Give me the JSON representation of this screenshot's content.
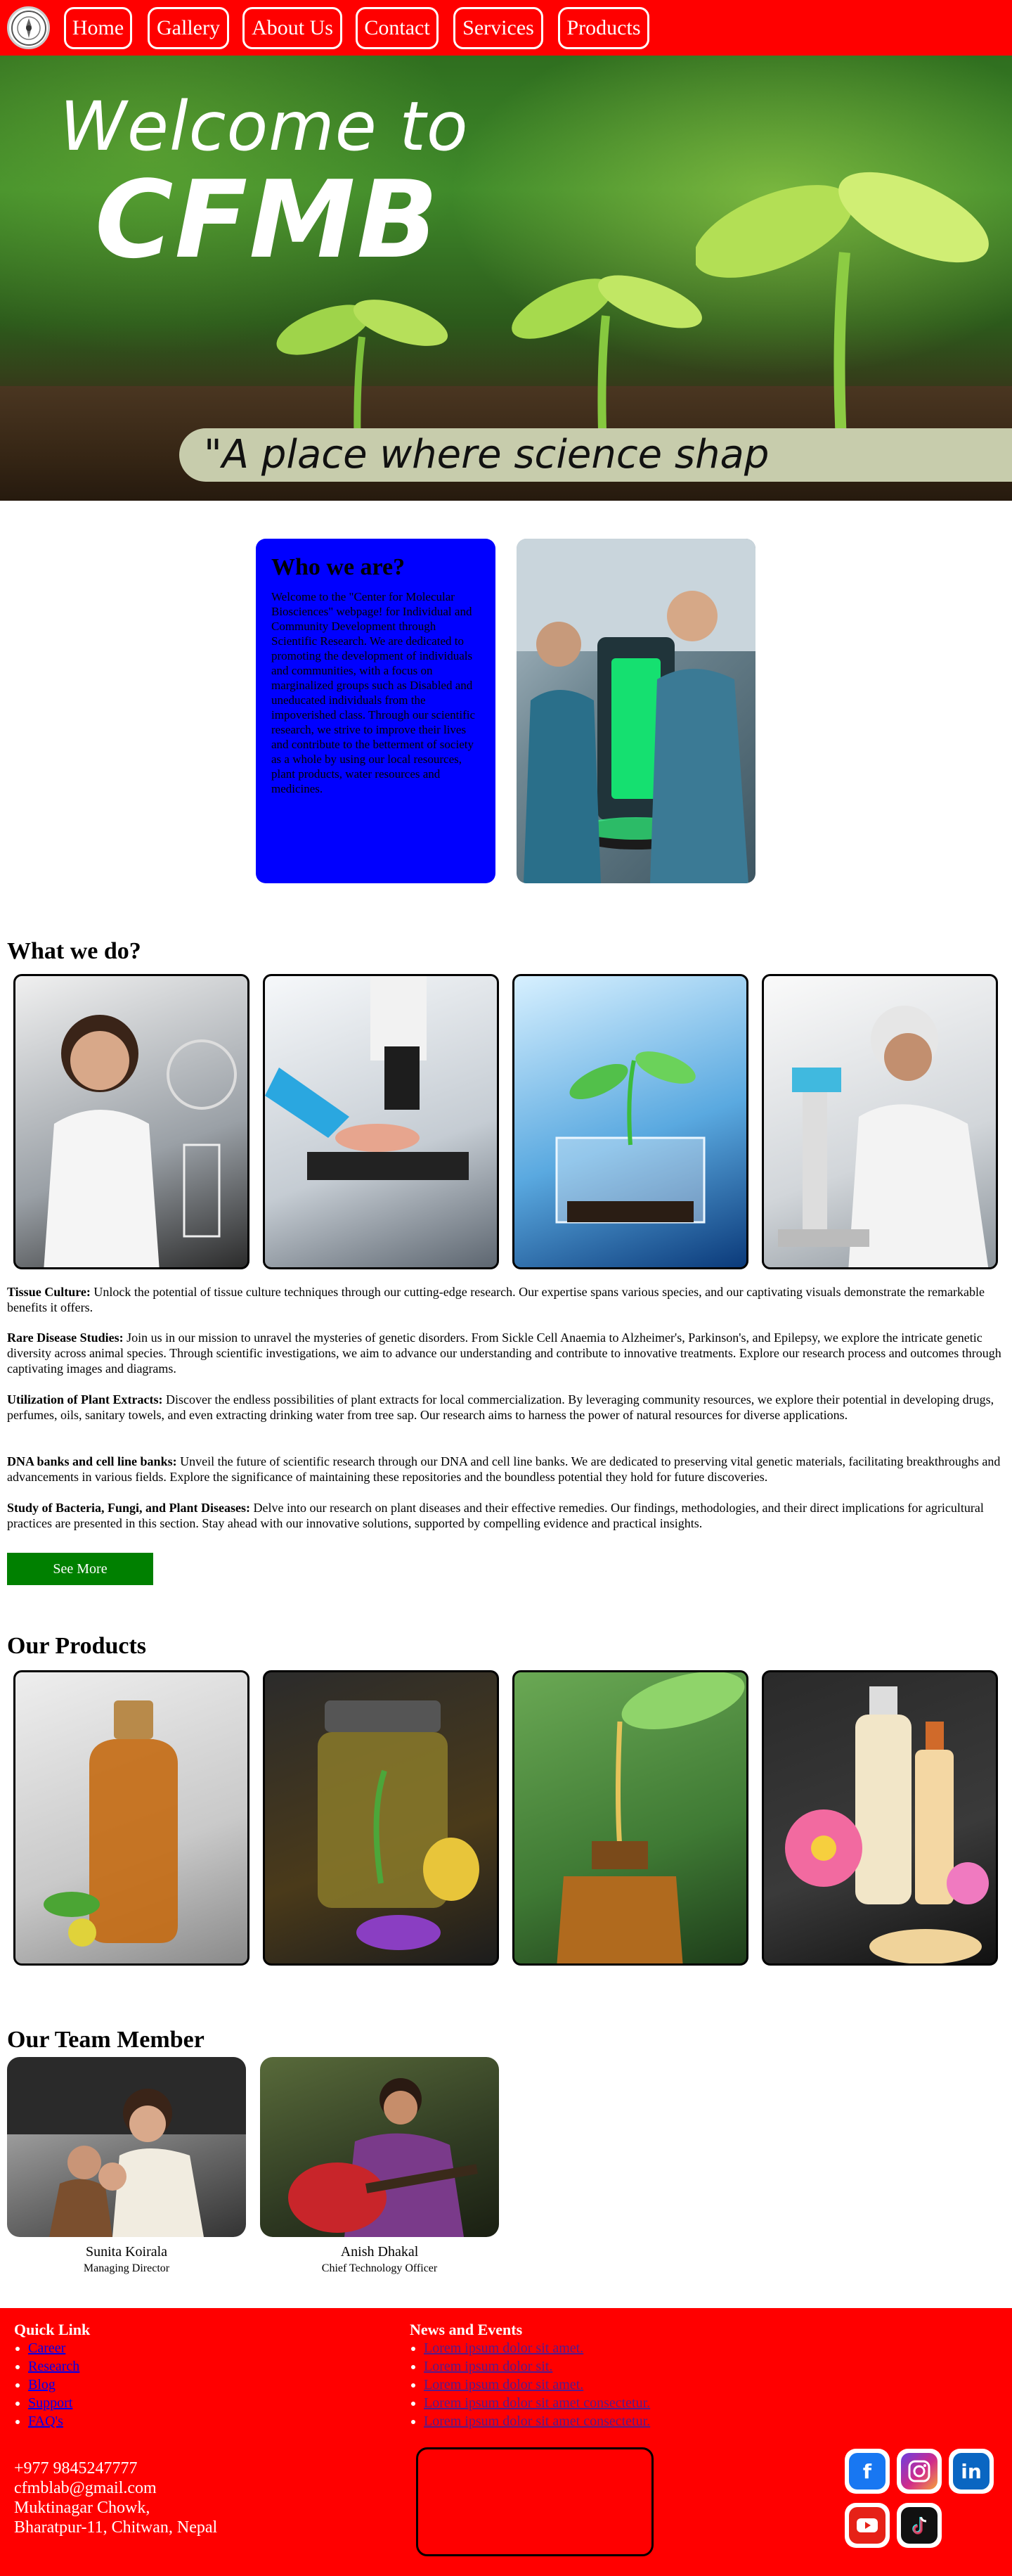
{
  "nav": {
    "logo": "cfmb-logo",
    "items": [
      {
        "label": "Home"
      },
      {
        "label": "Gallery"
      },
      {
        "label": "About Us"
      },
      {
        "label": "Contact"
      },
      {
        "label": "Services"
      },
      {
        "label": "Products"
      }
    ]
  },
  "hero": {
    "title_line1": "Welcome to",
    "title_line2": "CFMB",
    "tagline": "\"A place where science shap"
  },
  "who": {
    "title": "Who we are?",
    "text": "Welcome to the \"Center for Molecular Biosciences\" webpage! for Individual and Community Development through Scientific Research. We are dedicated to promoting the development of individuals and communities, with a focus on marginalized groups such as Disabled and uneducated individuals from the impoverished class. Through our scientific research, we strive to improve their lives and contribute to the betterment of society as a whole by using our local resources, plant products, water resources and medicines."
  },
  "what": {
    "heading": "What we do?",
    "items": [
      {
        "title": "Tissue Culture:",
        "text": " Unlock the potential of tissue culture techniques through our cutting-edge research. Our expertise spans various species, and our captivating visuals demonstrate the remarkable benefits it offers."
      },
      {
        "title": "Rare Disease Studies:",
        "text": " Join us in our mission to unravel the mysteries of genetic disorders. From Sickle Cell Anaemia to Alzheimer's, Parkinson's, and Epilepsy, we explore the intricate genetic diversity across animal species. Through scientific investigations, we aim to advance our understanding and contribute to innovative treatments. Explore our research process and outcomes through captivating images and diagrams."
      },
      {
        "title": "Utilization of Plant Extracts:",
        "text": " Discover the endless possibilities of plant extracts for local commercialization. By leveraging community resources, we explore their potential in developing drugs, perfumes, oils, sanitary towels, and even extracting drinking water from tree sap. Our research aims to harness the power of natural resources for diverse applications."
      },
      {
        "title": "DNA banks and cell line banks:",
        "text": " Unveil the future of scientific research through our DNA and cell line banks. We are dedicated to preserving vital genetic materials, facilitating breakthroughs and advancements in various fields. Explore the significance of maintaining these repositories and the boundless potential they hold for future discoveries."
      },
      {
        "title": "Study of Bacteria, Fungi, and Plant Diseases:",
        "text": " Delve into our research on plant diseases and their effective remedies. Our findings, methodologies, and their direct implications for agricultural practices are presented in this section. Stay ahead with our innovative solutions, supported by compelling evidence and practical insights."
      }
    ],
    "see_more": "See More"
  },
  "products": {
    "heading": "Our Products"
  },
  "team": {
    "heading": "Our Team Member",
    "members": [
      {
        "name": "Sunita Koirala",
        "role": "Managing Director"
      },
      {
        "name": "Anish Dhakal",
        "role": "Chief Technology Officer"
      }
    ]
  },
  "footer": {
    "quick_heading": "Quick Link",
    "quick_links": [
      "Career",
      "Research",
      "Blog",
      "Support",
      "FAQ's"
    ],
    "news_heading": "News and Events",
    "news_links": [
      "Lorem ipsum dolor sit amet.",
      "Lorem ipsum dolor sit.",
      "Lorem ipsum dolor sit amet.",
      "Lorem ipsum dolor sit amet consectetur.",
      "Lorem ipsum dolor sit amet consectetur."
    ],
    "phone": "+977 9845247777",
    "email": "cfmblab@gmail.com",
    "address1": "Muktinagar Chowk,",
    "address2": "Bharatpur-11, Chitwan, Nepal",
    "social": [
      "facebook-icon",
      "instagram-icon",
      "linkedin-icon",
      "youtube-icon",
      "tiktok-icon"
    ]
  },
  "colors": {
    "brand_red": "#ff0000",
    "who_blue": "#0000ff",
    "button_green": "#008000"
  }
}
